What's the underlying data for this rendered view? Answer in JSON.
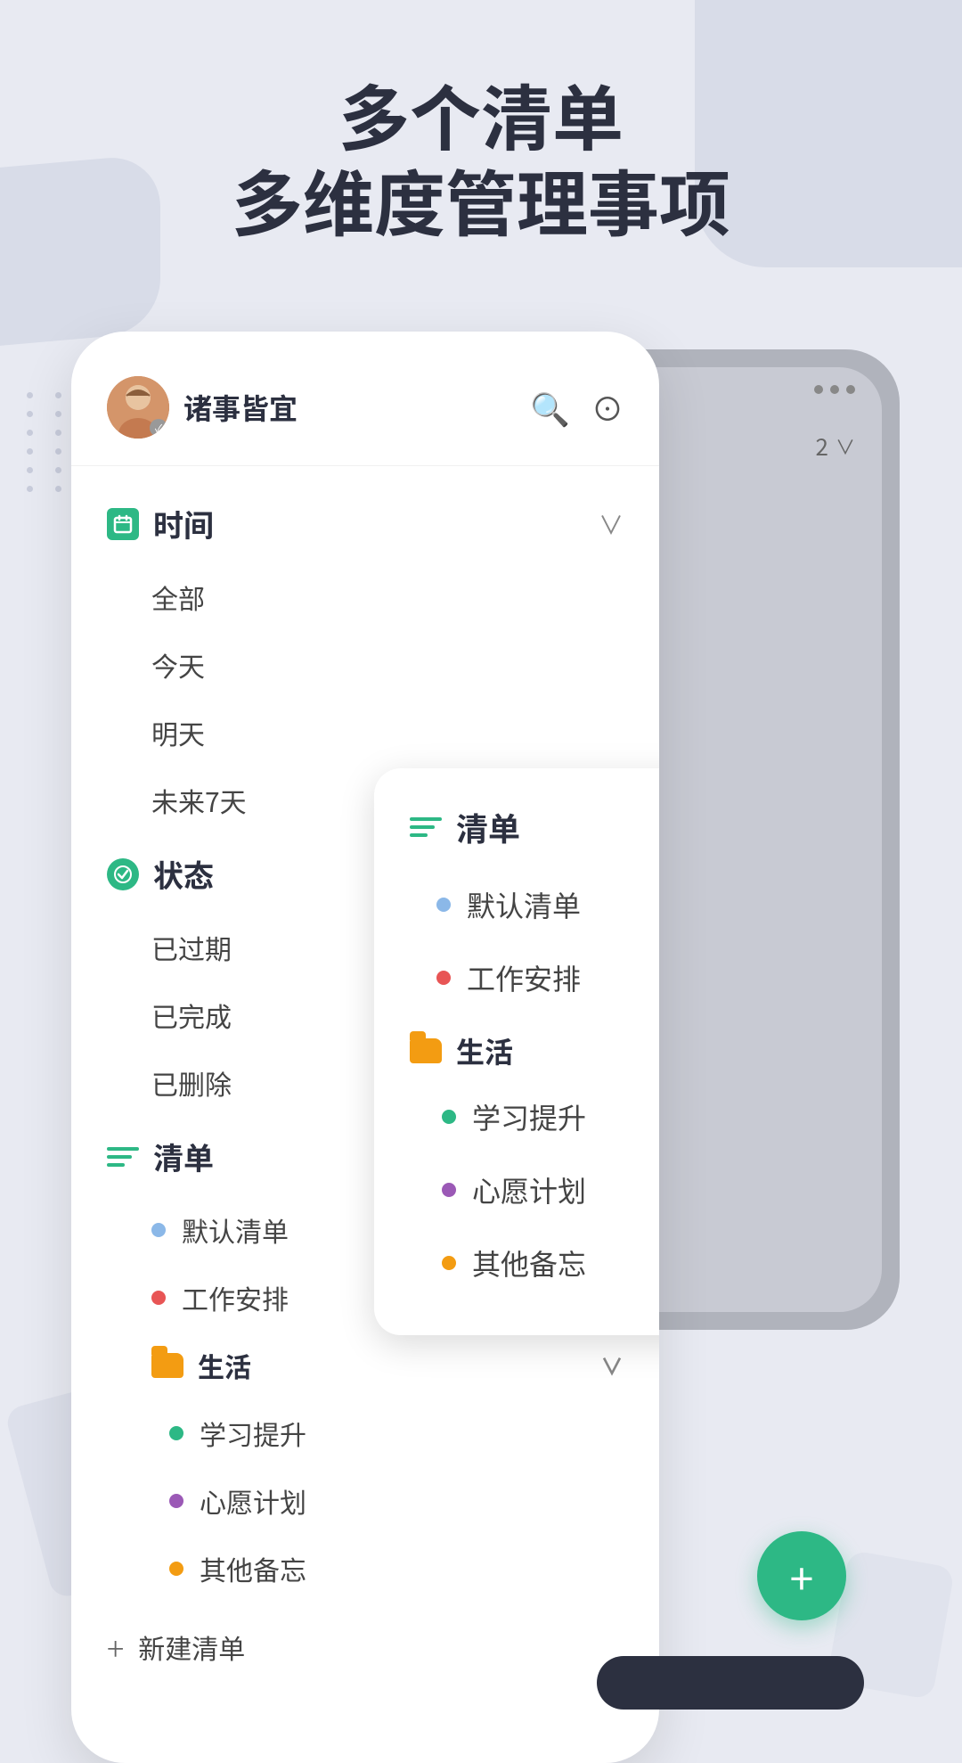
{
  "header": {
    "line1": "多个清单",
    "line2": "多维度管理事项"
  },
  "phone_main": {
    "user": {
      "name": "诸事皆宜"
    },
    "search_icon": "🔍",
    "settings_icon": "⊙",
    "sections": {
      "time": {
        "label": "时间",
        "items": [
          "全部",
          "今天",
          "明天",
          "未来7天"
        ]
      },
      "status": {
        "label": "状态",
        "items": [
          "已过期",
          "已完成",
          "已删除"
        ]
      },
      "list": {
        "label": "清单",
        "items": [
          {
            "label": "默认清单",
            "color": "blue"
          },
          {
            "label": "工作安排",
            "color": "red"
          }
        ],
        "folders": [
          {
            "name": "生活",
            "items": [
              {
                "label": "学习提升",
                "color": "green"
              },
              {
                "label": "心愿计划",
                "color": "purple"
              },
              {
                "label": "其他备忘",
                "color": "orange"
              }
            ]
          }
        ]
      }
    },
    "new_list_label": "新建清单"
  },
  "popup": {
    "section_label": "清单",
    "items": [
      {
        "label": "默认清单",
        "color": "blue"
      },
      {
        "label": "工作安排",
        "color": "red"
      }
    ],
    "folder": {
      "name": "生活",
      "items": [
        {
          "label": "学习提升",
          "color": "green"
        },
        {
          "label": "心愿计划",
          "color": "purple"
        },
        {
          "label": "其他备忘",
          "color": "orange"
        }
      ]
    }
  },
  "phone_bg": {
    "badge_count": "2"
  },
  "colors": {
    "accent": "#2db885",
    "background": "#e8eaf2",
    "title": "#2c3040"
  },
  "icons": {
    "chevron_down": "∨",
    "plus": "+",
    "search": "⌕",
    "more": "⋯"
  }
}
